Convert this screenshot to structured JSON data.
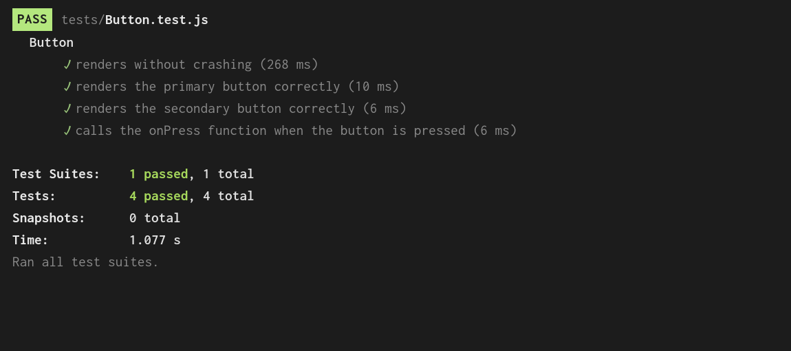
{
  "header": {
    "badge": "PASS",
    "path": "tests/",
    "file": "Button.test.js"
  },
  "suite": {
    "name": "Button",
    "tests": [
      {
        "name": "renders without crashing",
        "time": "268 ms"
      },
      {
        "name": "renders the primary button correctly",
        "time": "10 ms"
      },
      {
        "name": "renders the secondary button correctly",
        "time": "6 ms"
      },
      {
        "name": "calls the onPress function when the button is pressed",
        "time": "6 ms"
      }
    ]
  },
  "summary": {
    "suites_label": "Test Suites:",
    "suites_passed": "1 passed",
    "suites_total": ", 1 total",
    "tests_label": "Tests:",
    "tests_passed": "4 passed",
    "tests_total": ", 4 total",
    "snapshots_label": "Snapshots:",
    "snapshots_value": "0 total",
    "time_label": "Time:",
    "time_value": "1.077 s"
  },
  "footer": "Ran all test suites."
}
